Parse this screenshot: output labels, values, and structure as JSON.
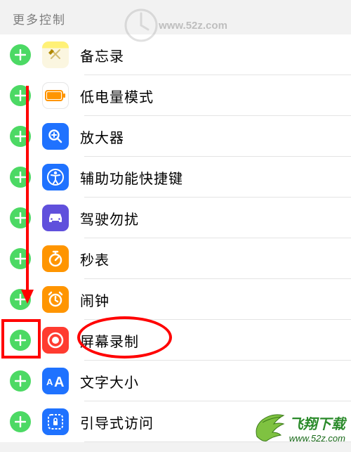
{
  "header": {
    "title": "更多控制"
  },
  "items": [
    {
      "label": "备忘录"
    },
    {
      "label": "低电量模式"
    },
    {
      "label": "放大器"
    },
    {
      "label": "辅助功能快捷键"
    },
    {
      "label": "驾驶勿扰"
    },
    {
      "label": "秒表"
    },
    {
      "label": "闹钟"
    },
    {
      "label": "屏幕录制"
    },
    {
      "label": "文字大小"
    },
    {
      "label": "引导式访问"
    }
  ],
  "watermark": {
    "center_text": "www.52z.com",
    "brand_line1": "飞翔下载",
    "brand_line2": "www.52z.com"
  }
}
